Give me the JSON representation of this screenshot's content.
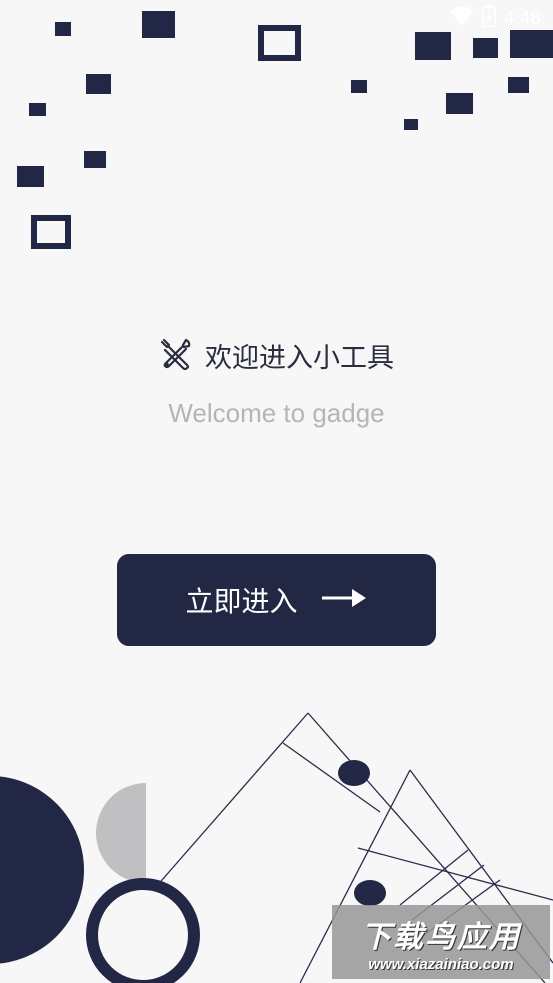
{
  "status_bar": {
    "time": "4:48",
    "wifi_icon": "wifi-icon",
    "battery_icon": "battery-charging-icon"
  },
  "welcome": {
    "title": "欢迎进入小工具",
    "subtitle": "Welcome to gadge",
    "icon": "tools-icon"
  },
  "enter_button": {
    "label": "立即进入",
    "icon": "arrow-right-icon"
  },
  "watermark": {
    "line1": "下载鸟应用",
    "line2": "www.xiazainiao.com"
  },
  "colors": {
    "navy": "#212744",
    "background": "#f7f7f8",
    "gray_shape": "#c0c0c2",
    "subtitle": "#b5b5b8"
  }
}
